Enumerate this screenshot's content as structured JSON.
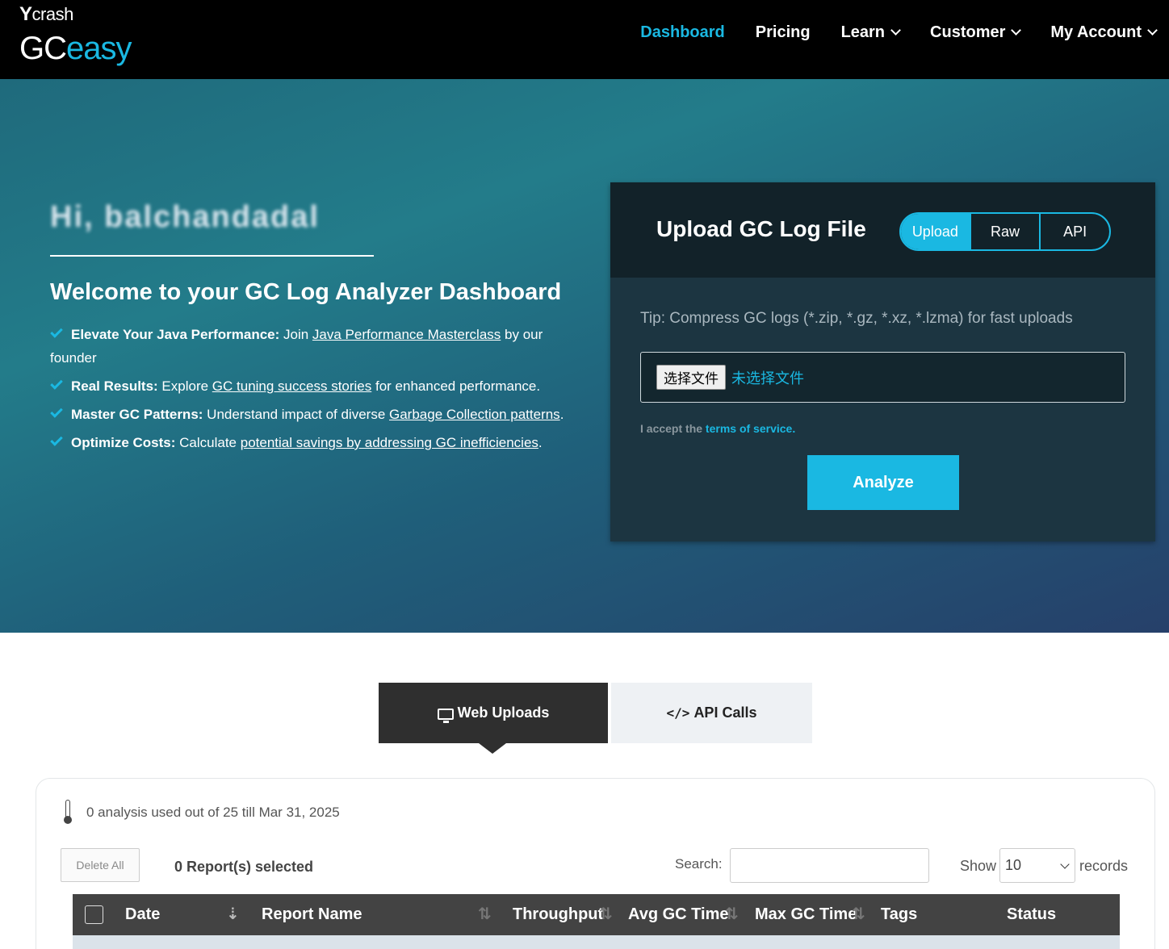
{
  "brand": {
    "top": "crash",
    "top_mark": "Y",
    "gc": "GC",
    "easy": "easy"
  },
  "nav": {
    "items": [
      {
        "label": "Dashboard",
        "active": true,
        "dropdown": false
      },
      {
        "label": "Pricing",
        "active": false,
        "dropdown": false
      },
      {
        "label": "Learn",
        "active": false,
        "dropdown": true
      },
      {
        "label": "Customer",
        "active": false,
        "dropdown": true
      },
      {
        "label": "My Account",
        "active": false,
        "dropdown": true
      }
    ]
  },
  "hero": {
    "greeting": "Hi, balchandadal",
    "title": "Welcome to your GC Log Analyzer Dashboard",
    "bullets": [
      {
        "bold": "Elevate Your Java Performance:",
        "pre": " Join ",
        "link": "Java Performance Masterclass",
        "post": " by our founder"
      },
      {
        "bold": "Real Results:",
        "pre": " Explore ",
        "link": "GC tuning success stories",
        "post": " for enhanced performance."
      },
      {
        "bold": "Master GC Patterns:",
        "pre": " Understand impact of diverse ",
        "link": "Garbage Collection patterns",
        "post": "."
      },
      {
        "bold": "Optimize Costs:",
        "pre": " Calculate ",
        "link": "potential savings by addressing GC inefficiencies",
        "post": "."
      }
    ]
  },
  "upload": {
    "title": "Upload GC Log File",
    "modes": [
      "Upload",
      "Raw",
      "API"
    ],
    "active_mode": "Upload",
    "tip": "Tip: Compress GC logs (*.zip, *.gz, *.xz, *.lzma) for fast uploads",
    "file_button": "选择文件",
    "file_status": "未选择文件",
    "terms_prefix": "I accept the ",
    "terms_link": "terms of service.",
    "analyze_label": "Analyze"
  },
  "tabs": {
    "web": "Web Uploads",
    "api": "API Calls",
    "api_icon_text": "</>",
    "active": "web"
  },
  "panel": {
    "usage": "0 analysis used out of 25 till Mar 31, 2025",
    "delete_all": "Delete All",
    "selected": "0 Report(s) selected",
    "search_label": "Search:",
    "search_value": "",
    "show_label": "Show",
    "show_value": "10",
    "records_label": "records",
    "columns": [
      "Date",
      "Report Name",
      "Throughput",
      "Avg GC Time",
      "Max GC Time",
      "Tags",
      "Status"
    ]
  },
  "colors": {
    "accent": "#1ab8e2",
    "nav_bg": "#000000",
    "card_bg": "#1c3541",
    "table_header": "#434343"
  }
}
